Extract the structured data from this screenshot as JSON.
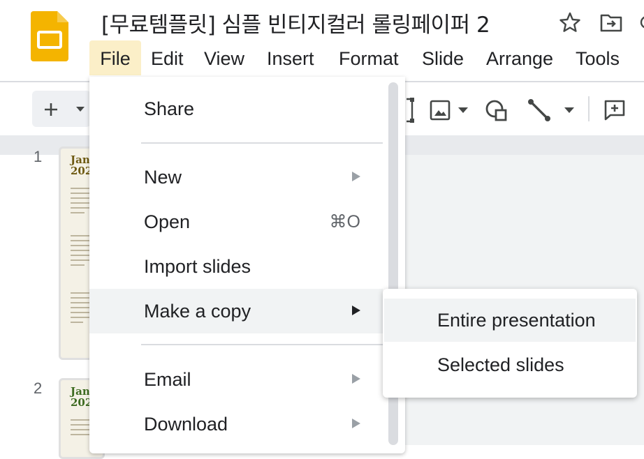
{
  "header": {
    "title": "[무료템플릿] 심플 빈티지컬러 롤링페이퍼 2",
    "logo_icon": "google-slides-logo-icon",
    "star_icon": "star-icon",
    "move_icon": "move-to-folder-icon"
  },
  "menubar": {
    "items": [
      "File",
      "Edit",
      "View",
      "Insert",
      "Format",
      "Slide",
      "Arrange",
      "Tools"
    ],
    "active": "File"
  },
  "toolbar": {
    "add_icon": "plus-icon",
    "dropdown_icon": "chevron-down-icon",
    "icons": [
      "select-icon",
      "image-icon",
      "shape-icon",
      "line-icon",
      "comment-icon"
    ]
  },
  "filmstrip": {
    "slides": [
      {
        "number": "1",
        "title": "Jan 202"
      },
      {
        "number": "2",
        "title": "Jan 202"
      }
    ]
  },
  "file_menu": {
    "items": [
      {
        "label": "Share",
        "shortcut": "",
        "submenu": false
      },
      {
        "label": "New",
        "shortcut": "",
        "submenu": true
      },
      {
        "label": "Open",
        "shortcut": "⌘O",
        "submenu": false
      },
      {
        "label": "Import slides",
        "shortcut": "",
        "submenu": false
      },
      {
        "label": "Make a copy",
        "shortcut": "",
        "submenu": true
      },
      {
        "label": "Email",
        "shortcut": "",
        "submenu": true
      },
      {
        "label": "Download",
        "shortcut": "",
        "submenu": true
      }
    ],
    "highlighted": "Make a copy"
  },
  "copy_submenu": {
    "items": [
      "Entire presentation",
      "Selected slides"
    ],
    "highlighted": "Entire presentation"
  },
  "colors": {
    "accent_active_menu": "#fbefc8",
    "slides_yellow": "#f4b400",
    "hover_gray": "#f1f3f4"
  }
}
